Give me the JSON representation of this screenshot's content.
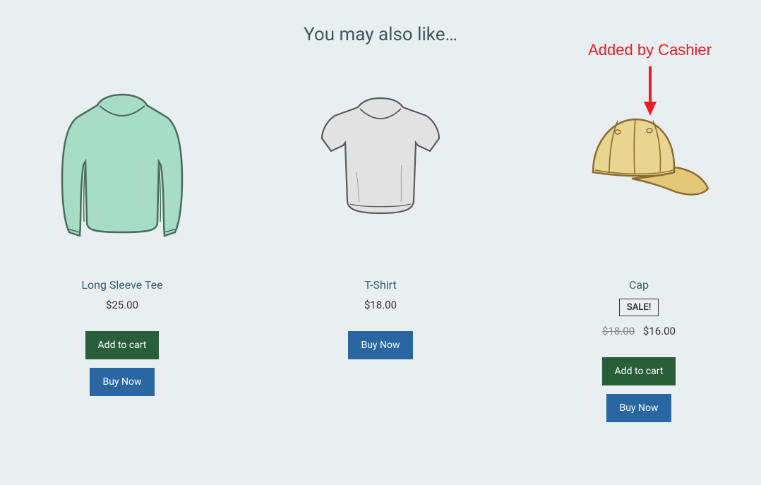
{
  "annotation": "Added by Cashier",
  "section_title": "You may also like…",
  "products": [
    {
      "title": "Long Sleeve Tee",
      "price": "$25.00",
      "add_to_cart_label": "Add to cart",
      "buy_now_label": "Buy Now"
    },
    {
      "title": "T-Shirt",
      "price": "$18.00",
      "buy_now_label": "Buy Now"
    },
    {
      "title": "Cap",
      "sale_badge": "SALE!",
      "old_price": "$18.00",
      "new_price": "$16.00",
      "add_to_cart_label": "Add to cart",
      "buy_now_label": "Buy Now"
    }
  ]
}
